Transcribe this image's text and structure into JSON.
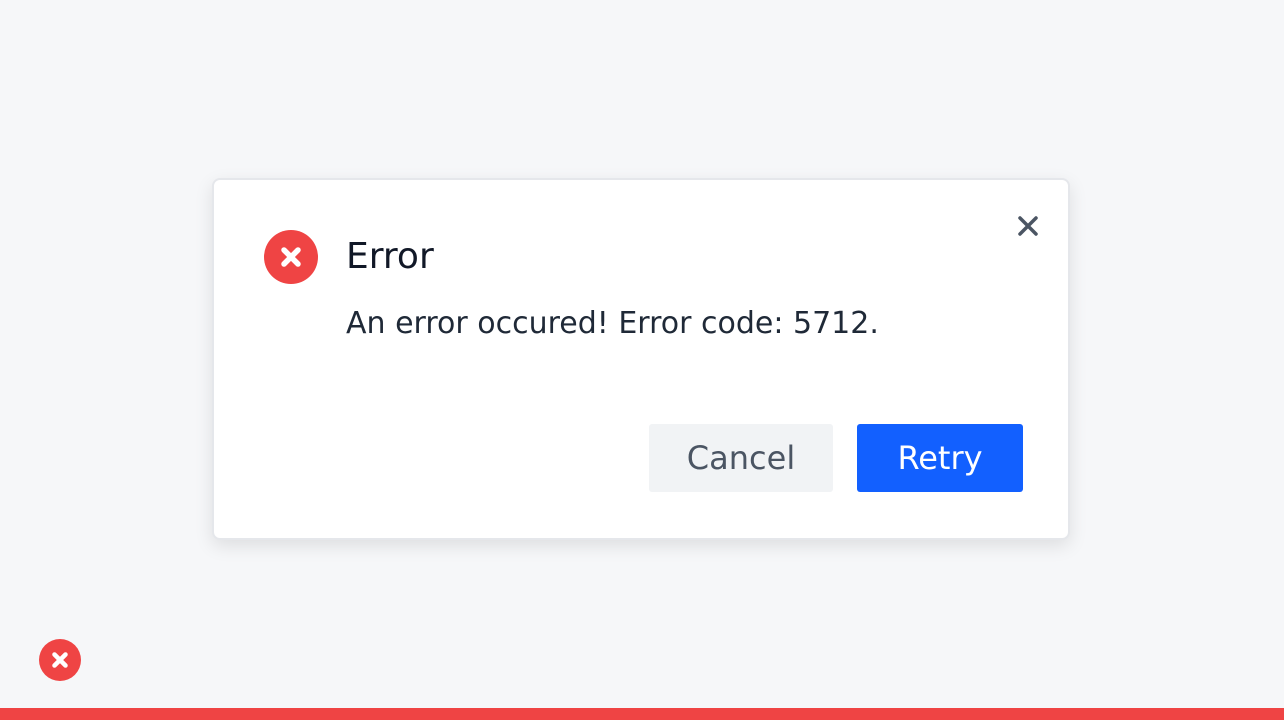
{
  "dialog": {
    "title": "Error",
    "message": "An error occured! Error code: 5712.",
    "icon": "error-x-circle-icon",
    "close_icon": "close-icon",
    "cancel_label": "Cancel",
    "retry_label": "Retry"
  },
  "status": {
    "icon": "error-x-circle-icon"
  },
  "colors": {
    "danger": "#ef4444",
    "primary": "#1260ff",
    "background": "#f6f7f9"
  }
}
